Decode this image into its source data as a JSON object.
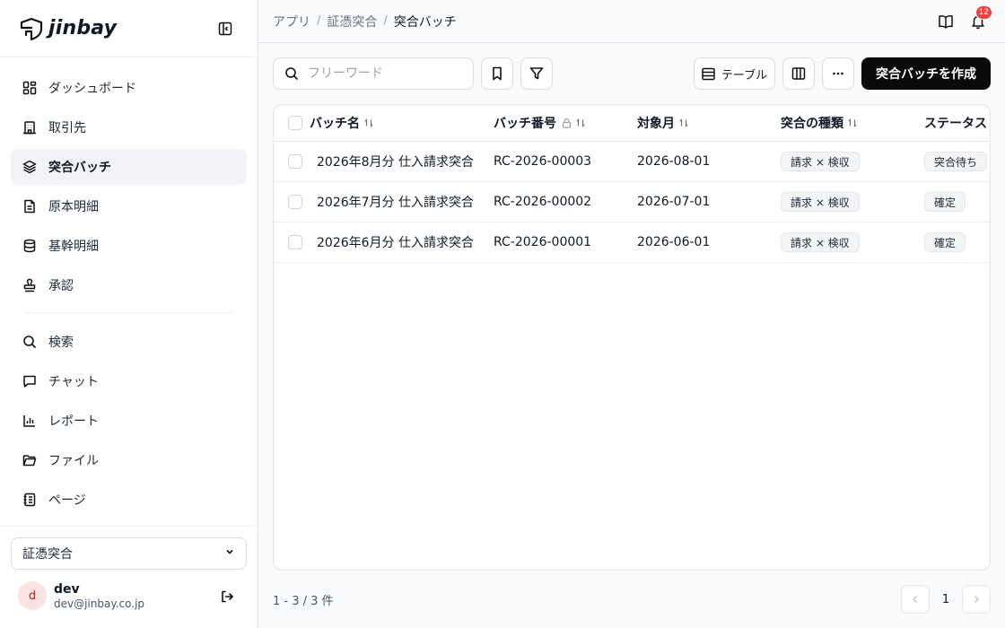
{
  "brand": {
    "name": "jinbay"
  },
  "sidebar": {
    "items": [
      {
        "label": "ダッシュボード",
        "icon": "dashboard-icon"
      },
      {
        "label": "取引先",
        "icon": "building-icon"
      },
      {
        "label": "突合バッチ",
        "icon": "layers-icon",
        "active": true
      },
      {
        "label": "原本明細",
        "icon": "document-icon"
      },
      {
        "label": "基幹明細",
        "icon": "database-icon"
      },
      {
        "label": "承認",
        "icon": "stamp-icon"
      }
    ],
    "items2": [
      {
        "label": "検索",
        "icon": "search-icon"
      },
      {
        "label": "チャット",
        "icon": "chat-icon"
      },
      {
        "label": "レポート",
        "icon": "chart-icon"
      },
      {
        "label": "ファイル",
        "icon": "folder-icon"
      },
      {
        "label": "ページ",
        "icon": "notebook-icon"
      }
    ],
    "workspace": "証憑突合",
    "user": {
      "initial": "d",
      "name": "dev",
      "email": "dev@jinbay.co.jp"
    }
  },
  "header": {
    "breadcrumb": [
      "アプリ",
      "証憑突合",
      "突合バッチ"
    ],
    "notification_count": "12"
  },
  "toolbar": {
    "search_placeholder": "フリーワード",
    "view_label": "テーブル",
    "create_label": "突合バッチを作成"
  },
  "table": {
    "columns": [
      "バッチ名",
      "バッチ番号",
      "対象月",
      "突合の種類",
      "ステータス"
    ],
    "rows": [
      {
        "name": "2026年8月分 仕入請求突合",
        "number": "RC-2026-00003",
        "month": "2026-08-01",
        "type": "請求 × 検収",
        "status": "突合待ち"
      },
      {
        "name": "2026年7月分 仕入請求突合",
        "number": "RC-2026-00002",
        "month": "2026-07-01",
        "type": "請求 × 検収",
        "status": "確定"
      },
      {
        "name": "2026年6月分 仕入請求突合",
        "number": "RC-2026-00001",
        "month": "2026-06-01",
        "type": "請求 × 検収",
        "status": "確定"
      }
    ]
  },
  "footer": {
    "count": "1 - 3 / 3 件",
    "page": "1"
  },
  "colors": {
    "accent": "#0a0a0a",
    "badge": "#ef4444",
    "active_bg": "#f1f3f6"
  }
}
